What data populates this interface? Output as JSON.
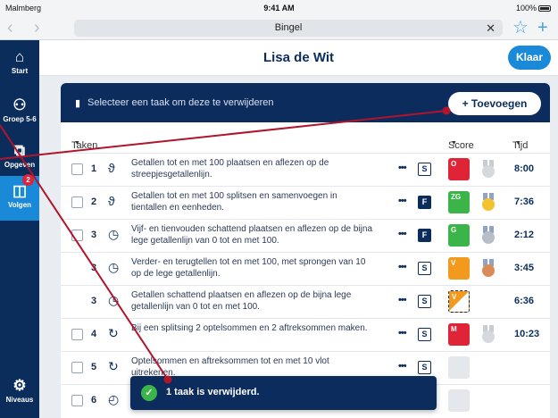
{
  "status": {
    "carrier": "Malmberg",
    "time": "9:41 AM",
    "battery": "100%"
  },
  "browser": {
    "url_title": "Bingel",
    "clear": "✕",
    "back": "‹",
    "forward": "›",
    "star": "☆",
    "plus": "+"
  },
  "sidebar": {
    "items": [
      {
        "label": "Start",
        "icon": "home-icon",
        "glyph": "⌂"
      },
      {
        "label": "Groep 5-6",
        "icon": "group-icon",
        "glyph": "⚇"
      },
      {
        "label": "Opgeven",
        "icon": "assign-icon",
        "glyph": "⧉"
      },
      {
        "label": "Volgen",
        "icon": "track-icon",
        "glyph": "◫",
        "badge": "2"
      },
      {
        "label": "Niveaus",
        "icon": "gear-icon",
        "glyph": "⚙"
      }
    ]
  },
  "header": {
    "title": "Lisa de Wit",
    "done": "Klaar"
  },
  "toolbar": {
    "hint": "Selecteer een taak om deze te verwijderen",
    "add": "+ Toevoegen"
  },
  "columns": {
    "tasks": "Taken",
    "score": "Score",
    "time": "Tijd",
    "caret": "▼"
  },
  "rows": [
    {
      "num": "1",
      "icon": "ϑ",
      "text": "Getallen tot en met 100 plaatsen en aflezen op de streepjesgetallenlijn.",
      "type": "S",
      "score": "O",
      "time": "8:00"
    },
    {
      "num": "2",
      "icon": "ϑ",
      "text": "Getallen tot en met 100 splitsen en samenvoegen in tientallen en eenheden.",
      "type": "F",
      "score": "ZG",
      "time": "7:36"
    },
    {
      "num": "3",
      "icon": "◷",
      "text": "Vijf- en tienvouden schattend plaatsen en aflezen op de bijna lege getallenlijn van 0 tot en met 100.",
      "type": "F",
      "score": "G",
      "time": "2:12"
    },
    {
      "num": "3",
      "icon": "◷",
      "text": "Verder- en terugtellen tot en met 100, met sprongen van 10 op de lege getallenlijn.",
      "type": "S",
      "score": "V",
      "time": "3:45"
    },
    {
      "num": "3",
      "icon": "◷",
      "text": "Getallen schattend plaatsen en aflezen op de bijna lege getallenlijn van 0 tot en met 100.",
      "type": "S",
      "score": "V",
      "time": "6:36"
    },
    {
      "num": "4",
      "icon": "↻",
      "text": "Bij een splitsing 2 optelsommen en 2 aftreksommen maken.",
      "type": "S",
      "score": "M",
      "time": "10:23"
    },
    {
      "num": "5",
      "icon": "↻",
      "text": "Optelsommen en aftreksommen tot en met 10 vlot uitrekenen.",
      "type": "S",
      "score": "",
      "time": ""
    },
    {
      "num": "6",
      "icon": "◴",
      "text": "",
      "type": "",
      "score": "",
      "time": ""
    }
  ],
  "toast": {
    "message": "1 taak is verwijderd.",
    "check": "✓"
  },
  "colors": {
    "navy": "#0d2c5e",
    "accent": "#1a89d8",
    "danger": "#e02437",
    "success": "#3bb54a",
    "orange": "#f39a1e"
  }
}
